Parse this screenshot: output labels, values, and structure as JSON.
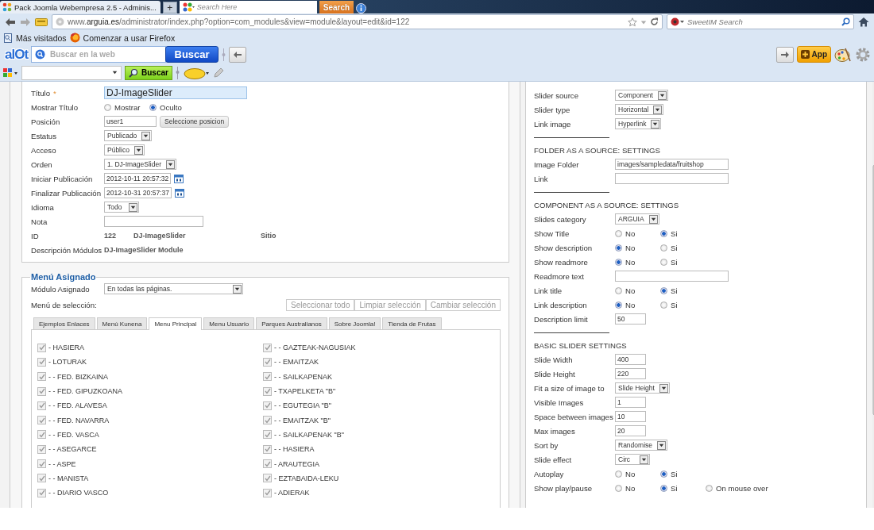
{
  "browser": {
    "tab": {
      "title": "Pack Joomla Webempresa 2.5 - Adminis..."
    },
    "new_tab": "+",
    "tab_search": {
      "placeholder": "Search Here",
      "button": "Search"
    },
    "url": "www.**arguia.es**/administrator/index.php?option=com_modules&view=module&layout=edit&id=122",
    "search": {
      "placeholder": "SweetIM Search"
    },
    "bookmarks": [
      "Más visitados",
      "Comenzar a usar Firefox"
    ],
    "alot_toolbar": {
      "logo": "alOt",
      "placeholder": "Buscar en la web",
      "button": "Buscar",
      "app_button": "App"
    },
    "second_toolbar": {
      "button": "Buscar"
    }
  },
  "module_details": {
    "fields": [
      {
        "kind": "text",
        "label": "Título",
        "mark": "*",
        "value": "DJ-ImageSlider",
        "focused": true
      },
      {
        "kind": "radio",
        "label": "Mostrar Título",
        "options": [
          {
            "label": "Mostrar",
            "selected": false
          },
          {
            "label": "Oculto",
            "selected": true
          }
        ]
      },
      {
        "kind": "text_button",
        "label": "Posición",
        "value": "user1",
        "button": "Seleccione posicion"
      },
      {
        "kind": "select",
        "label": "Estatus",
        "value": "Publicado"
      },
      {
        "kind": "select",
        "label": "Acceso",
        "value": "Público"
      },
      {
        "kind": "select",
        "label": "Orden",
        "value": "1. DJ-ImageSlider"
      },
      {
        "kind": "date",
        "label": "Iniciar Publicación",
        "value": "2012-10-11 20:57:32"
      },
      {
        "kind": "date",
        "label": "Finalizar Publicación",
        "value": "2012-10-31 20:57:37"
      },
      {
        "kind": "select",
        "label": "Idioma",
        "value": "Todo"
      },
      {
        "kind": "text",
        "label": "Nota",
        "focused": false
      },
      {
        "kind": "static",
        "label": "ID",
        "values": [
          "122",
          "DJ-ImageSlider",
          "Sitio"
        ]
      },
      {
        "kind": "static",
        "label": "Descripción Módulos",
        "values": [
          "DJ-ImageSlider Module"
        ]
      }
    ]
  },
  "menu_assignment": {
    "legend": "Menú Asignado",
    "assigned_label": "Módulo Asignado",
    "assigned_value": "En todas las páginas.",
    "selection_label": "Menú de selección:",
    "buttons": [
      "Seleccionar todo",
      "Limpiar selección",
      "Cambiar selección"
    ],
    "tabs": [
      {
        "label": "Ejemplos Enlaces",
        "selected": false
      },
      {
        "label": "Menú Kunena",
        "selected": false
      },
      {
        "label": "Menu Principal",
        "selected": true
      },
      {
        "label": "Menu Usuario",
        "selected": false
      },
      {
        "label": "Parques Australianos",
        "selected": false
      },
      {
        "label": "Sobre Joomla!",
        "selected": false
      },
      {
        "label": "Tienda de Frutas",
        "selected": false
      }
    ],
    "columns": [
      {
        "items": [
          {
            "label": "- HASIERA",
            "checked": true
          },
          {
            "label": "- LOTURAK",
            "checked": true
          },
          {
            "label": "- - FED. BIZKAINA",
            "checked": true
          },
          {
            "label": "- - FED. GIPUZKOANA",
            "checked": true
          },
          {
            "label": "- - FED. ALAVESA",
            "checked": true
          },
          {
            "label": "- - FED. NAVARRA",
            "checked": true
          },
          {
            "label": "- - FED. VASCA",
            "checked": true
          },
          {
            "label": "- - ASEGARCE",
            "checked": true
          },
          {
            "label": "- - ASPE",
            "checked": true
          },
          {
            "label": "- - MANISTA",
            "checked": true
          },
          {
            "label": "- - DIARIO VASCO",
            "checked": true
          }
        ]
      },
      {
        "items": [
          {
            "label": "- - GAZTEAK-NAGUSIAK",
            "checked": true
          },
          {
            "label": "- - EMAITZAK",
            "checked": true
          },
          {
            "label": "- - SAILKAPENAK",
            "checked": true
          },
          {
            "label": "- TXAPELKETA \"B\"",
            "checked": true
          },
          {
            "label": "- - EGUTEGIA \"B\"",
            "checked": true
          },
          {
            "label": "- - EMAITZAK \"B\"",
            "checked": true
          },
          {
            "label": "- - SAILKAPENAK \"B\"",
            "checked": true
          },
          {
            "label": "- - HASIERA",
            "checked": true
          },
          {
            "label": "- ARAUTEGIA",
            "checked": true
          },
          {
            "label": "- EZTABAIDA-LEKU",
            "checked": true
          },
          {
            "label": "- ADIERAK",
            "checked": true
          }
        ]
      }
    ]
  },
  "options": {
    "fields": [
      {
        "kind": "select",
        "label": "Slider source",
        "value": "Component"
      },
      {
        "kind": "select",
        "label": "Slider type",
        "value": "Horizontal"
      },
      {
        "kind": "select",
        "label": "Link image",
        "value": "Hyperlink"
      },
      {
        "kind": "separator"
      },
      {
        "kind": "heading",
        "label": "FOLDER AS A SOURCE: SETTINGS"
      },
      {
        "kind": "text",
        "label": "Image Folder",
        "value": "images/sampledata/fruitshop",
        "focused": false
      },
      {
        "kind": "text",
        "label": "Link",
        "focused": false
      },
      {
        "kind": "separator"
      },
      {
        "kind": "heading",
        "label": "COMPONENT AS A SOURCE: SETTINGS"
      },
      {
        "kind": "select",
        "label": "Slides category",
        "value": "ARGUIA"
      },
      {
        "kind": "radio",
        "label": "Show Title",
        "options": [
          {
            "label": "No",
            "selected": false
          },
          {
            "label": "Si",
            "selected": true
          }
        ]
      },
      {
        "kind": "radio",
        "label": "Show description",
        "options": [
          {
            "label": "No",
            "selected": true
          },
          {
            "label": "Si",
            "selected": false
          }
        ]
      },
      {
        "kind": "radio",
        "label": "Show readmore",
        "options": [
          {
            "label": "No",
            "selected": true
          },
          {
            "label": "Si",
            "selected": false
          }
        ]
      },
      {
        "kind": "text",
        "label": "Readmore text",
        "focused": false
      },
      {
        "kind": "radio",
        "label": "Link title",
        "options": [
          {
            "label": "No",
            "selected": false
          },
          {
            "label": "Si",
            "selected": true
          }
        ]
      },
      {
        "kind": "radio",
        "label": "Link description",
        "options": [
          {
            "label": "No",
            "selected": true
          },
          {
            "label": "Si",
            "selected": false
          }
        ]
      },
      {
        "kind": "text",
        "label": "Description limit",
        "value": "50",
        "focused": false
      },
      {
        "kind": "separator"
      },
      {
        "kind": "heading",
        "label": "BASIC SLIDER SETTINGS"
      },
      {
        "kind": "text",
        "label": "Slide Width",
        "value": "400",
        "focused": false
      },
      {
        "kind": "text",
        "label": "Slide Height",
        "value": "220",
        "focused": false
      },
      {
        "kind": "select",
        "label": "Fit a size of image to",
        "value": "Slide Height"
      },
      {
        "kind": "text",
        "label": "Visible Images",
        "value": "1",
        "focused": false
      },
      {
        "kind": "text",
        "label": "Space between images",
        "value": "10",
        "focused": false
      },
      {
        "kind": "text",
        "label": "Max images",
        "value": "20",
        "focused": false
      },
      {
        "kind": "select",
        "label": "Sort by",
        "value": "Randomise"
      },
      {
        "kind": "select",
        "label": "Slide effect",
        "value": "Circ"
      },
      {
        "kind": "radio",
        "label": "Autoplay",
        "options": [
          {
            "label": "No",
            "selected": false
          },
          {
            "label": "Si",
            "selected": true
          }
        ]
      },
      {
        "kind": "radio",
        "label": "Show play/pause",
        "options": [
          {
            "label": "No",
            "selected": false
          },
          {
            "label": "Si",
            "selected": true
          },
          {
            "label": "On mouse over",
            "selected": false
          }
        ]
      }
    ]
  }
}
